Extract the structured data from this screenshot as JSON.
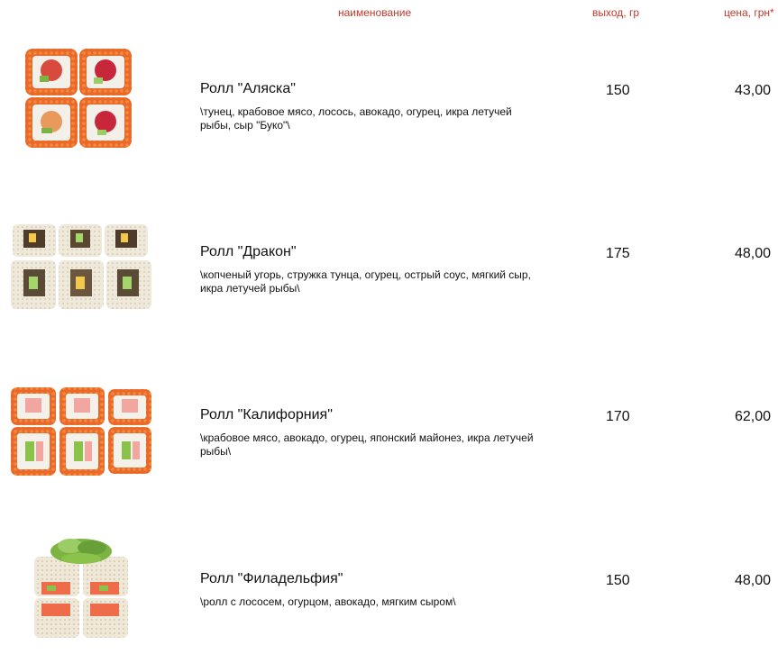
{
  "header": {
    "name": "наименование",
    "output": "выход, гр",
    "price": "цена, грн*"
  },
  "items": [
    {
      "title": "Ролл \"Аляска\"",
      "desc": "\\тунец, крабовое мясо, лосось, авокадо, огурец, икра летучей рыбы, сыр \"Буко\"\\",
      "output": "150",
      "price": "43,00",
      "image": "sushi-roll-orange-roe-icon"
    },
    {
      "title": "Ролл \"Дракон\"",
      "desc": "\\копченый угорь, стружка тунца, огурец, острый соус, мягкий сыр, икра летучей рыбы\\",
      "output": "175",
      "price": "48,00",
      "image": "sushi-roll-sesame-icon"
    },
    {
      "title": "Ролл \"Калифорния\"",
      "desc": "\\крабовое мясо, авокадо, огурец, японский майонез, икра летучей рыбы\\",
      "output": "170",
      "price": "62,00",
      "image": "sushi-roll-orange-roe-icon"
    },
    {
      "title": "Ролл \"Филадельфия\"",
      "desc": "\\ролл с лососем, огурцом, авокадо, мягким сыром\\",
      "output": "150",
      "price": "48,00",
      "image": "sushi-roll-salad-icon"
    }
  ]
}
